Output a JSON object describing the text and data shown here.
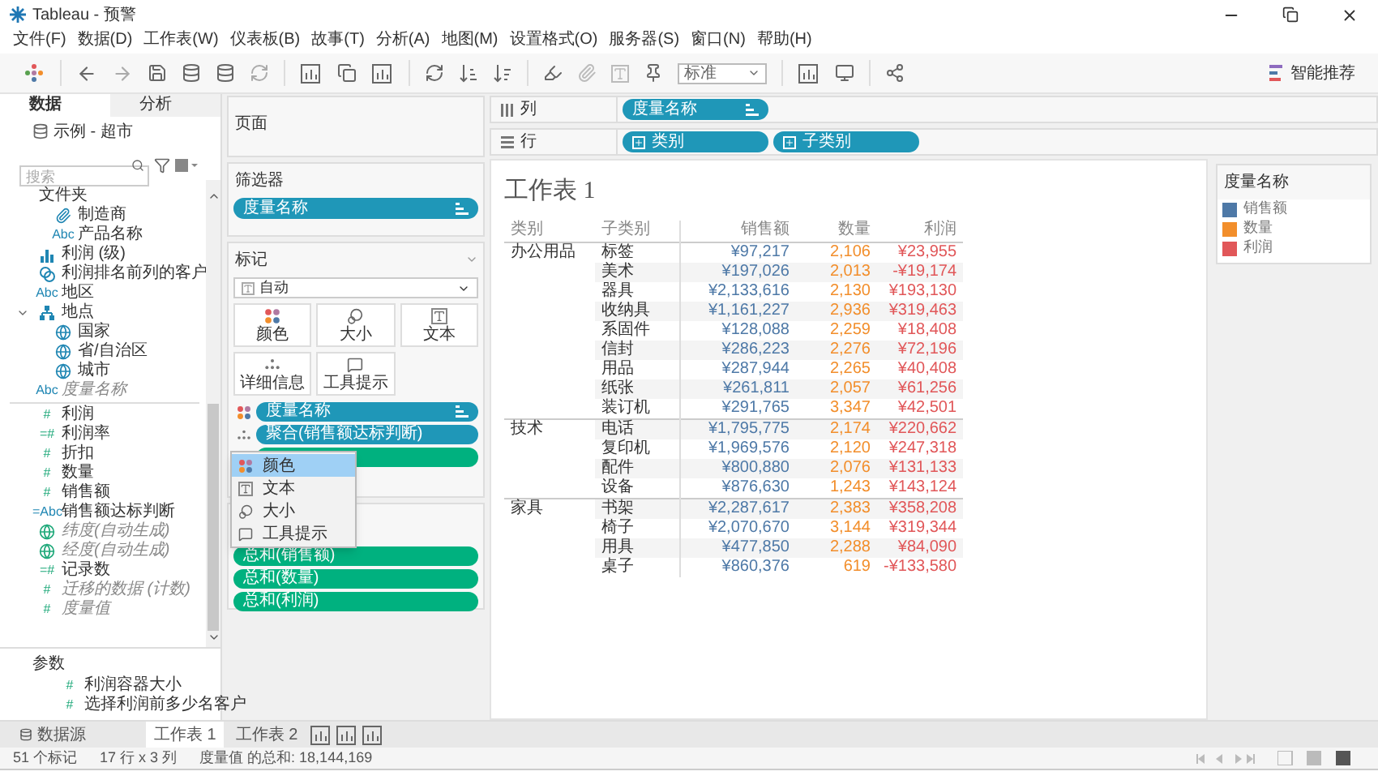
{
  "window": {
    "title": "Tableau - 预警"
  },
  "menu": [
    "文件(F)",
    "数据(D)",
    "工作表(W)",
    "仪表板(B)",
    "故事(T)",
    "分析(A)",
    "地图(M)",
    "设置格式(O)",
    "服务器(S)",
    "窗口(N)",
    "帮助(H)"
  ],
  "toolbar": {
    "format_select": "标准",
    "recommend_button": "智能推荐"
  },
  "left_pane": {
    "tabs": [
      {
        "label": "数据",
        "selected": true
      },
      {
        "label": "分析",
        "selected": false
      }
    ],
    "data_source": "示例 - 超市",
    "search": {
      "placeholder": "搜索"
    },
    "fields": [
      {
        "label": "文件夹",
        "kind": "folder",
        "italic": false,
        "children": [
          {
            "label": "制造商",
            "kind": "group",
            "italic": false
          },
          {
            "label": "产品名称",
            "glyph": "Abc",
            "kind": "dimension",
            "italic": false
          }
        ]
      },
      {
        "label": "利润 (级)",
        "kind": "bin",
        "italic": false
      },
      {
        "label": "利润排名前列的客户",
        "kind": "set",
        "italic": false
      },
      {
        "label": "地区",
        "glyph": "Abc",
        "kind": "dimension",
        "italic": false
      },
      {
        "label": "地点",
        "kind": "hierarchy",
        "italic": false,
        "expanded": true,
        "children": [
          {
            "label": "国家",
            "kind": "geo",
            "italic": false
          },
          {
            "label": "省/自治区",
            "kind": "geo",
            "italic": false
          },
          {
            "label": "城市",
            "kind": "geo",
            "italic": false
          }
        ]
      },
      {
        "label": "度量名称",
        "glyph": "Abc",
        "kind": "dimension",
        "italic": true
      }
    ],
    "measures": [
      {
        "label": "利润",
        "glyph": "#",
        "kind": "measure",
        "italic": false
      },
      {
        "label": "利润率",
        "glyph": "=#",
        "kind": "measure",
        "italic": false
      },
      {
        "label": "折扣",
        "glyph": "#",
        "kind": "measure",
        "italic": false
      },
      {
        "label": "数量",
        "glyph": "#",
        "kind": "measure",
        "italic": false
      },
      {
        "label": "销售额",
        "glyph": "#",
        "kind": "measure",
        "italic": false
      },
      {
        "label": "销售额达标判断",
        "glyph": "=Abc",
        "kind": "dimension",
        "italic": false
      },
      {
        "label": "纬度(自动生成)",
        "kind": "geo_measure",
        "italic": true
      },
      {
        "label": "经度(自动生成)",
        "kind": "geo_measure",
        "italic": true
      },
      {
        "label": "记录数",
        "glyph": "=#",
        "kind": "measure",
        "italic": false
      },
      {
        "label": "迁移的数据 (计数)",
        "glyph": "#",
        "kind": "measure",
        "italic": true
      },
      {
        "label": "度量值",
        "glyph": "#",
        "kind": "measure",
        "italic": true
      }
    ],
    "parameters_title": "参数",
    "parameters": [
      {
        "label": "利润容器大小",
        "glyph": "#",
        "kind": "measure",
        "italic": false
      },
      {
        "label": "选择利润前多少名客户",
        "glyph": "#",
        "kind": "measure",
        "italic": false
      }
    ]
  },
  "pages_card": {
    "title": "页面"
  },
  "filters_card": {
    "title": "筛选器",
    "pills": [
      {
        "label": "度量名称"
      }
    ]
  },
  "marks_card": {
    "title": "标记",
    "mark_type": "自动",
    "buttons": [
      {
        "label": "颜色",
        "kind": "color"
      },
      {
        "label": "大小",
        "kind": "size"
      },
      {
        "label": "文本",
        "kind": "text"
      },
      {
        "label": "详细信息",
        "kind": "detail"
      },
      {
        "label": "工具提示",
        "kind": "tooltip"
      }
    ],
    "pills": [
      {
        "label": "度量名称",
        "kind": "color",
        "continuous": false
      },
      {
        "label": "聚合(销售额达标判断)",
        "kind": "detail",
        "continuous": false
      },
      {
        "continuous": true
      }
    ]
  },
  "popup_menu": [
    {
      "label": "颜色",
      "kind": "color",
      "selected": true
    },
    {
      "label": "文本",
      "kind": "text",
      "selected": false
    },
    {
      "label": "大小",
      "kind": "size",
      "selected": false
    },
    {
      "label": "工具提示",
      "kind": "tooltip",
      "selected": false
    }
  ],
  "measure_values_card": {
    "pills": [
      {
        "label": "总和(销售额)"
      },
      {
        "label": "总和(数量)"
      },
      {
        "label": "总和(利润)"
      }
    ]
  },
  "columns_shelf": {
    "label": "列",
    "pills": [
      {
        "label": "度量名称"
      }
    ]
  },
  "rows_shelf": {
    "label": "行",
    "pills": [
      {
        "label": "类别"
      },
      {
        "label": "子类别"
      }
    ]
  },
  "sheet": {
    "title": "工作表 1",
    "columns": [
      {
        "label": "类别"
      },
      {
        "label": "子类别"
      },
      {
        "label": "销售额",
        "color": "#4e79a7"
      },
      {
        "label": "数量",
        "color": "#f28e2b"
      },
      {
        "label": "利润",
        "color": "#e15759"
      }
    ],
    "groups": [
      {
        "category": "办公用品",
        "rows": [
          [
            "标签",
            "¥97,217",
            "2,106",
            "¥23,955"
          ],
          [
            "美术",
            "¥197,026",
            "2,013",
            "-¥19,174"
          ],
          [
            "器具",
            "¥2,133,616",
            "2,130",
            "¥193,130"
          ],
          [
            "收纳具",
            "¥1,161,227",
            "2,936",
            "¥319,463"
          ],
          [
            "系固件",
            "¥128,088",
            "2,259",
            "¥18,408"
          ],
          [
            "信封",
            "¥286,223",
            "2,276",
            "¥72,196"
          ],
          [
            "用品",
            "¥287,944",
            "2,265",
            "¥40,408"
          ],
          [
            "纸张",
            "¥261,811",
            "2,057",
            "¥61,256"
          ],
          [
            "装订机",
            "¥291,765",
            "3,347",
            "¥42,501"
          ]
        ]
      },
      {
        "category": "技术",
        "rows": [
          [
            "电话",
            "¥1,795,775",
            "2,174",
            "¥220,662"
          ],
          [
            "复印机",
            "¥1,969,576",
            "2,120",
            "¥247,318"
          ],
          [
            "配件",
            "¥800,880",
            "2,076",
            "¥131,133"
          ],
          [
            "设备",
            "¥876,630",
            "1,243",
            "¥143,124"
          ]
        ]
      },
      {
        "category": "家具",
        "rows": [
          [
            "书架",
            "¥2,287,617",
            "2,383",
            "¥358,208"
          ],
          [
            "椅子",
            "¥2,070,670",
            "3,144",
            "¥319,344"
          ],
          [
            "用具",
            "¥477,850",
            "2,288",
            "¥84,090"
          ],
          [
            "桌子",
            "¥860,376",
            "619",
            "-¥133,580"
          ]
        ]
      }
    ]
  },
  "legend": {
    "title": "度量名称",
    "items": [
      {
        "label": "销售额",
        "color": "#4e79a7"
      },
      {
        "label": "数量",
        "color": "#f28e2b"
      },
      {
        "label": "利润",
        "color": "#e15759"
      }
    ]
  },
  "sheet_tabs": {
    "data_source": "数据源",
    "tabs": [
      {
        "label": "工作表 1",
        "selected": true
      },
      {
        "label": "工作表 2",
        "selected": false
      }
    ]
  },
  "status_bar": [
    "51 个标记",
    "17 行 x 3 列",
    "度量值 的总和: 18,144,169"
  ]
}
